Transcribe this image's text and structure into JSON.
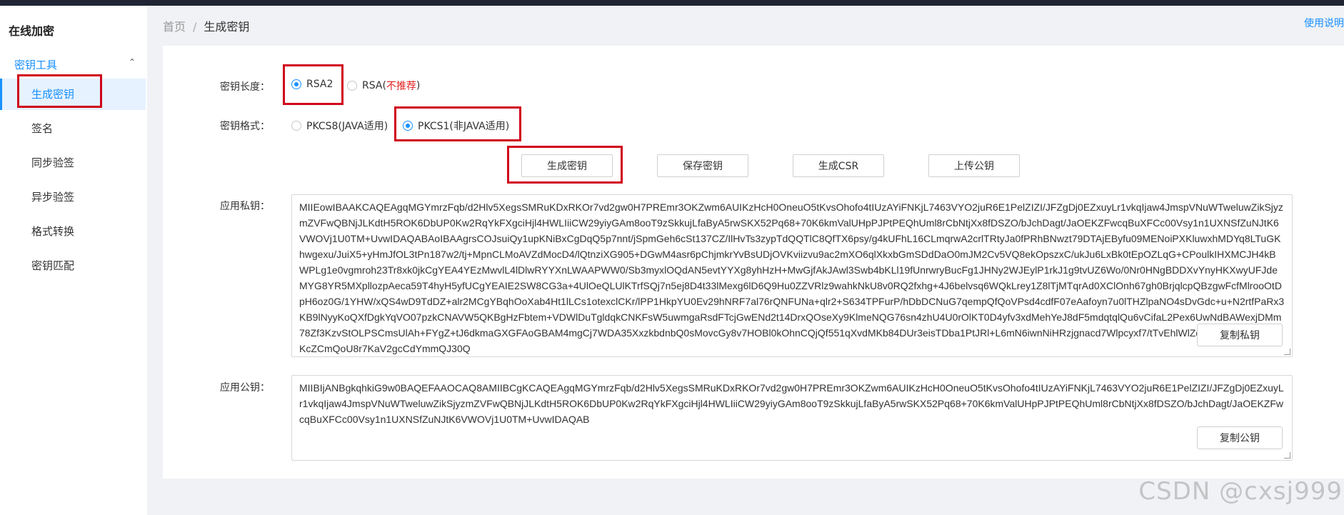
{
  "app": {
    "title": "在线加密"
  },
  "sidebar": {
    "group_label": "密钥工具",
    "items": [
      {
        "label": "生成密钥",
        "active": true
      },
      {
        "label": "签名"
      },
      {
        "label": "同步验签"
      },
      {
        "label": "异步验签"
      },
      {
        "label": "格式转换"
      },
      {
        "label": "密钥匹配"
      }
    ]
  },
  "breadcrumb": {
    "home": "首页",
    "separator": "/",
    "current": "生成密钥"
  },
  "help_link": "使用说明",
  "form": {
    "key_length": {
      "label": "密钥长度：",
      "options": [
        {
          "label": "RSA2",
          "selected": true
        },
        {
          "label": "RSA(",
          "note": "不推荐",
          "suffix": ")",
          "selected": false
        }
      ]
    },
    "key_format": {
      "label": "密钥格式：",
      "options": [
        {
          "label": "PKCS8(JAVA适用)",
          "selected": false
        },
        {
          "label": "PKCS1(非JAVA适用)",
          "selected": true
        }
      ]
    },
    "buttons": {
      "generate": "生成密钥",
      "save": "保存密钥",
      "csr": "生成CSR",
      "upload": "上传公钥"
    },
    "private_key": {
      "label": "应用私钥：",
      "value": "MIIEowIBAAKCAQEAgqMGYmrzFqb/d2Hlv5XegsSMRuKDxRKOr7vd2gw0H7PREmr3OKZwm6AUIKzHcH0OneuO5tKvsOhofo4tIUzAYiFNKjL7463VYO2juR6E1PelZIZI/JFZgDj0EZxuyLr1vkqIjaw4JmspVNuWTweluwZikSjyzmZVFwQBNjJLKdtH5ROK6DbUP0Kw2RqYkFXgciHjl4HWLIiiCW29yiyGAm8ooT9zSkkujLfaByA5rwSKX52Pq68+70K6kmValUHpPJPtPEQhUml8rCbNtjXx8fDSZO/bJchDagt/JaOEKZFwcqBuXFCc00Vsy1n1UXNSfZuNJtK6VWOVj1U0TM+UvwIDAQABAoIBAAgrsCOJsuiQy1upKNiBxCgDqQ5p7nnt/jSpmGeh6cSt137CZ/IlHvTs3zypTdQQTlC8QfTX6psy/g4kUFhL16CLmqrwA2crlTRtyJa0fPRhBNwzt79DTAjEByfu09MENoiPXKluwxhMDYq8LTuGKhwgexu/JuiX5+yHmJfOL3tPn187w2/tj+MpnCLMoAVZdMocD4/lQtnziXG905+DGwM4asr6pChjmkrYvBsUDjOVKviizvu9ac2mXO6qlXkxbGmSDdDaO0mJM2Cv5VQ8ekOpszxC/ukJu6LxBk0tEpOZLqG+CPoulkIHXMCJH4kBWPLg1e0vgmroh23Tr8xk0jkCgYEA4YEzMwvlL4lDlwRYYXnLWAAPWW0/Sb3myxlOQdAN5evtYYXg8yhHzH+MwGjfAkJAwl3Swb4bKLl19fUnrwryBucFg1JHNy2WJEylP1rkJ1g9tvUZ6Wo/0Nr0HNgBDDXvYnyHKXwyUFJdeMYG8YR5MXpllozpAeca59T4hyH5yfUCgYEAIE2SW8CG3a+4UlOeQLUlKTrfSQj7n5ej8D4t33lMexg6lD6Q9Hu0ZZVRlz9wahkNkU8v0RQ2fxhg+4J6belvsq6WQkLrey1Z8lTjMTqrAd0XClOnh67gh0BrjqlcpQBzgwFcfMlrooOtDpH6oz0G/1YHW/xQS4wD9TdDZ+alr2MCgYBqhOoXab4Ht1lLCs1otexclCKr/lPP1HkpYU0Ev29hNRF7al76rQNFUNa+qlr2+S634TPFurP/hDbDCNuG7qempQfQoVPsd4cdfF07eAafoyn7u0lTHZlpaNO4sDvGdc+u+N2rtfPaRx3KB9lNyyKoQXfDgkYqVO07pzkCNAVW5QKBgHzFbtem+VDWlDuTgldqkCNKFsW5uwmgaRsdFTcjGwENd2t14DrxQOseXy9KlmeNQG76sn4zhU4U0rOlKT0D4yfv3xdMehYeJ8dF5mdqtqlQu6vCifaL2Pex6UwNdBAWexjDMm78Zf3KzvStOLPSCmsUlAh+FYgZ+tJ6dkmaGXGFAoGBAM4mgCj7WDA35XxzkbdnbQ0sMovcGy8v7HOBl0kOhnCQjQf551qXvdMKb84DUr3eisTDba1PtJRl+L6mN6iwnNiHRzjgnacd7Wlpcyxf7/tTvEhlWlZdX5j5lRaXsUWdFYKcZCmQoU8r7KaV2gcCdYmmQJ30Q",
      "copy_label": "复制私钥"
    },
    "public_key": {
      "label": "应用公钥：",
      "value": "MIIBIjANBgkqhkiG9w0BAQEFAAOCAQ8AMIIBCgKCAQEAgqMGYmrzFqb/d2Hlv5XegsSMRuKDxRKOr7vd2gw0H7PREmr3OKZwm6AUIKzHcH0OneuO5tKvsOhofo4tIUzAYiFNKjL7463VYO2juR6E1PelZIZI/JFZgDj0EZxuyLr1vkqIjaw4JmspVNuWTweluwZikSjyzmZVFwQBNjJLKdtH5ROK6DbUP0Kw2RqYkFXgciHjl4HWLIiiCW29yiyGAm8ooT9zSkkujLfaByA5rwSKX52Pq68+70K6kmValUHpPJPtPEQhUml8rCbNtjXx8fDSZO/bJchDagt/JaOEKZFwcqBuXFCc00Vsy1n1UXNSfZuNJtK6VWOVj1U0TM+UvwIDAQAB",
      "copy_label": "复制公钥"
    }
  },
  "watermark": "CSDN @cxsj999",
  "colors": {
    "accent": "#1890ff",
    "highlight": "#d0021b",
    "warning": "#e02020"
  }
}
